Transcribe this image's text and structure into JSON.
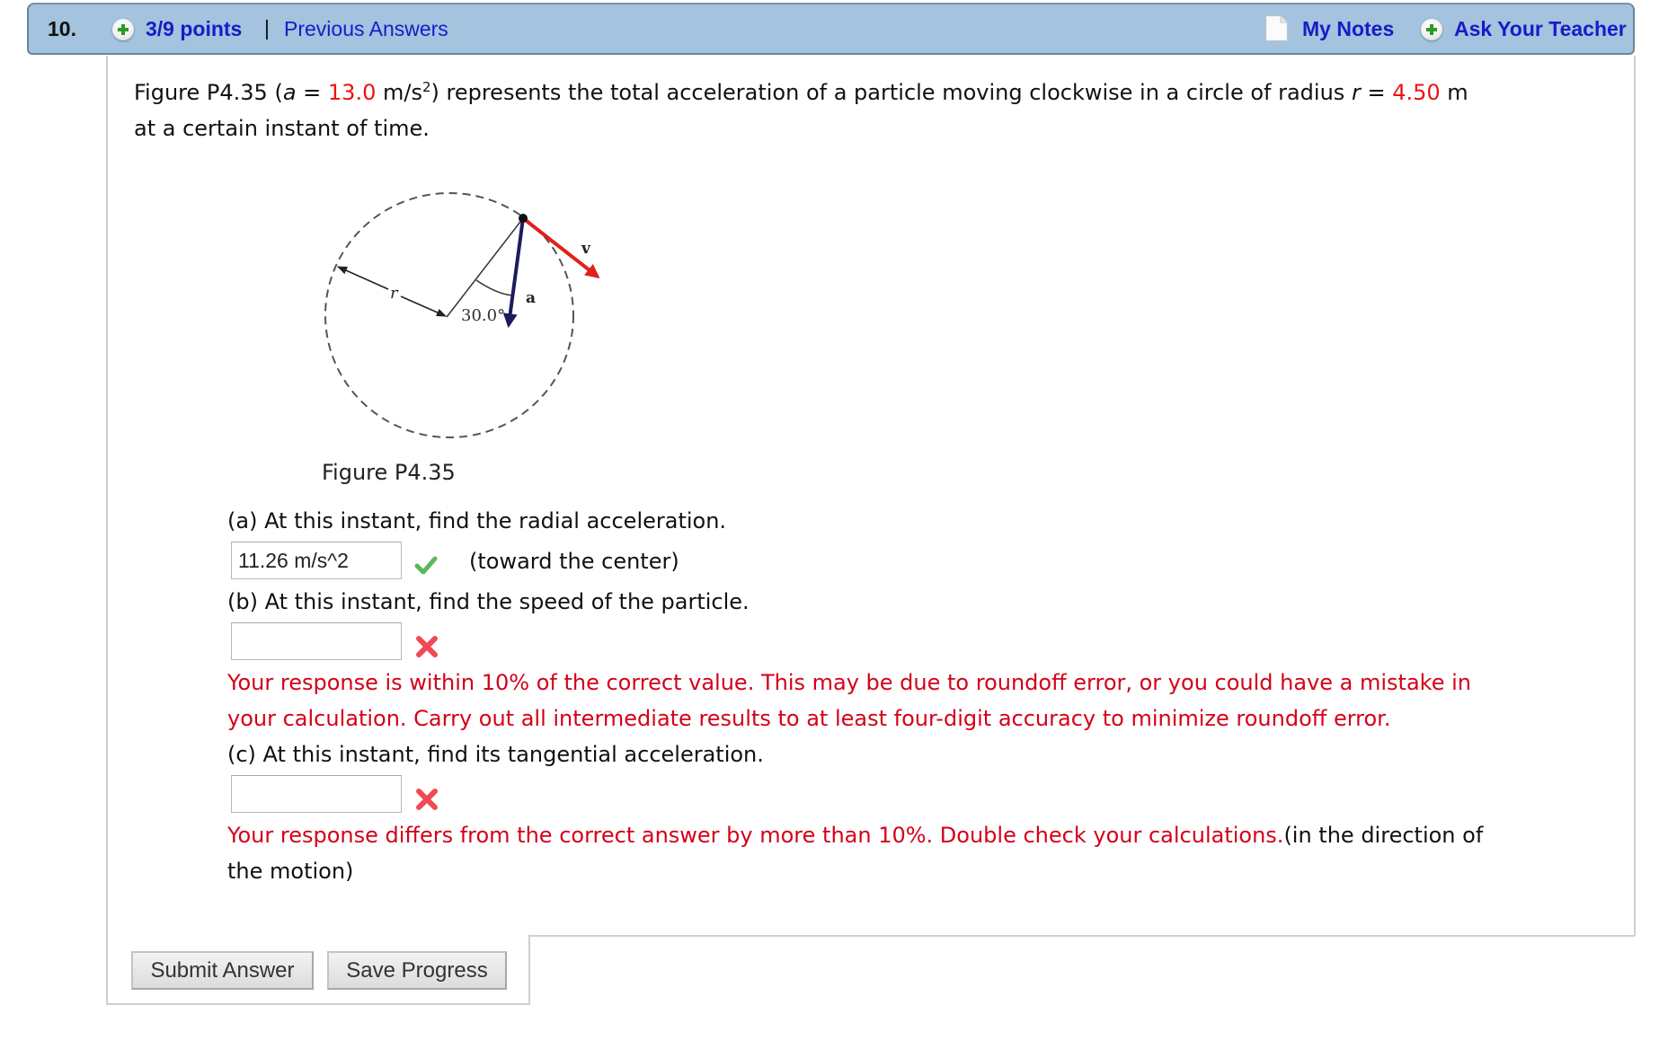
{
  "header": {
    "question_number": "10.",
    "points": "3/9 points",
    "separator": "|",
    "previous_answers": "Previous Answers",
    "my_notes": "My Notes",
    "ask_teacher": "Ask Your Teacher",
    "icons": {
      "points": "plus-circle-icon",
      "notes": "note-page-icon",
      "ask_teacher": "plus-circle-icon"
    }
  },
  "problem": {
    "intro_part1": "Figure P4.35 (",
    "a_symbol": "a",
    "equals1": " = ",
    "a_value": "13.0",
    "a_unit": " m/s",
    "a_unit_exp": "2",
    "intro_part2": ") represents the total acceleration of a particle moving clockwise in a circle of radius ",
    "r_symbol": "r",
    "equals2": " = ",
    "r_value": "4.50",
    "r_unit": " m",
    "line2": "at a certain instant of time."
  },
  "figure": {
    "caption": "Figure P4.35",
    "labels": {
      "radius": "r",
      "angle": "30.0°",
      "acceleration": "a",
      "velocity": "v"
    },
    "colors": {
      "velocity": "#e0201c",
      "acceleration": "#1c1c5c",
      "circle": "#555555"
    }
  },
  "parts": [
    {
      "label": "(a) At this instant, find the radial acceleration.",
      "input_value": "11.26 m/s^2",
      "status": "correct",
      "status_icon": "check-icon",
      "suffix": "(toward the center)"
    },
    {
      "label": "(b) At this instant, find the speed of the particle.",
      "input_value": "",
      "status": "incorrect",
      "status_icon": "x-icon",
      "feedback_line1": "Your response is within 10% of the correct value. This may be due to roundoff error, or you could have a mistake in",
      "feedback_line2": "your calculation. Carry out all intermediate results to at least four-digit accuracy to minimize roundoff error."
    },
    {
      "label": "(c) At this instant, find its tangential acceleration.",
      "input_value": "",
      "status": "incorrect",
      "status_icon": "x-icon",
      "feedback": "Your response differs from the correct answer by more than 10%. Double check your calculations.",
      "suffix_line1": "(in the direction of",
      "suffix_line2": "the motion)"
    }
  ],
  "buttons": {
    "submit": "Submit Answer",
    "save": "Save Progress"
  },
  "colors": {
    "header_bg": "#a3c3de",
    "link": "#1a1ac8",
    "feedback_red": "#d40019",
    "value_red": "#ee1111",
    "correct_green": "#4cae4c",
    "incorrect_red": "#f04a55"
  }
}
